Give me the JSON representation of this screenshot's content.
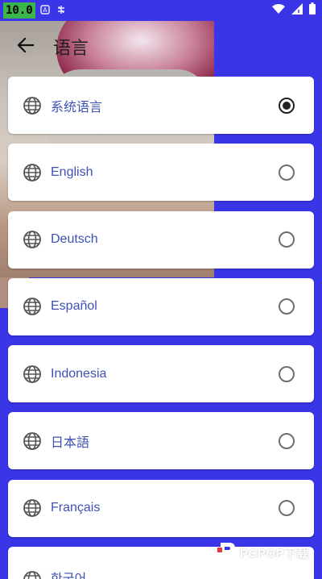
{
  "status_bar": {
    "time": "10.0",
    "icons": [
      "a-icon",
      "bug-icon",
      "wifi-icon",
      "signal-icon",
      "battery-icon"
    ]
  },
  "app_bar": {
    "title": "语言",
    "back_icon": "arrow-left-icon"
  },
  "languages": [
    {
      "label": "系统语言",
      "selected": true
    },
    {
      "label": "English",
      "selected": false
    },
    {
      "label": "Deutsch",
      "selected": false
    },
    {
      "label": "Español",
      "selected": false
    },
    {
      "label": "Indonesia",
      "selected": false
    },
    {
      "label": "日本語",
      "selected": false
    },
    {
      "label": "Français",
      "selected": false
    },
    {
      "label": "한국어",
      "selected": false
    }
  ],
  "watermark": {
    "text": "PCPOP下载"
  },
  "colors": {
    "background": "#3a36e8",
    "label": "#3f51b5",
    "card": "#ffffff"
  }
}
